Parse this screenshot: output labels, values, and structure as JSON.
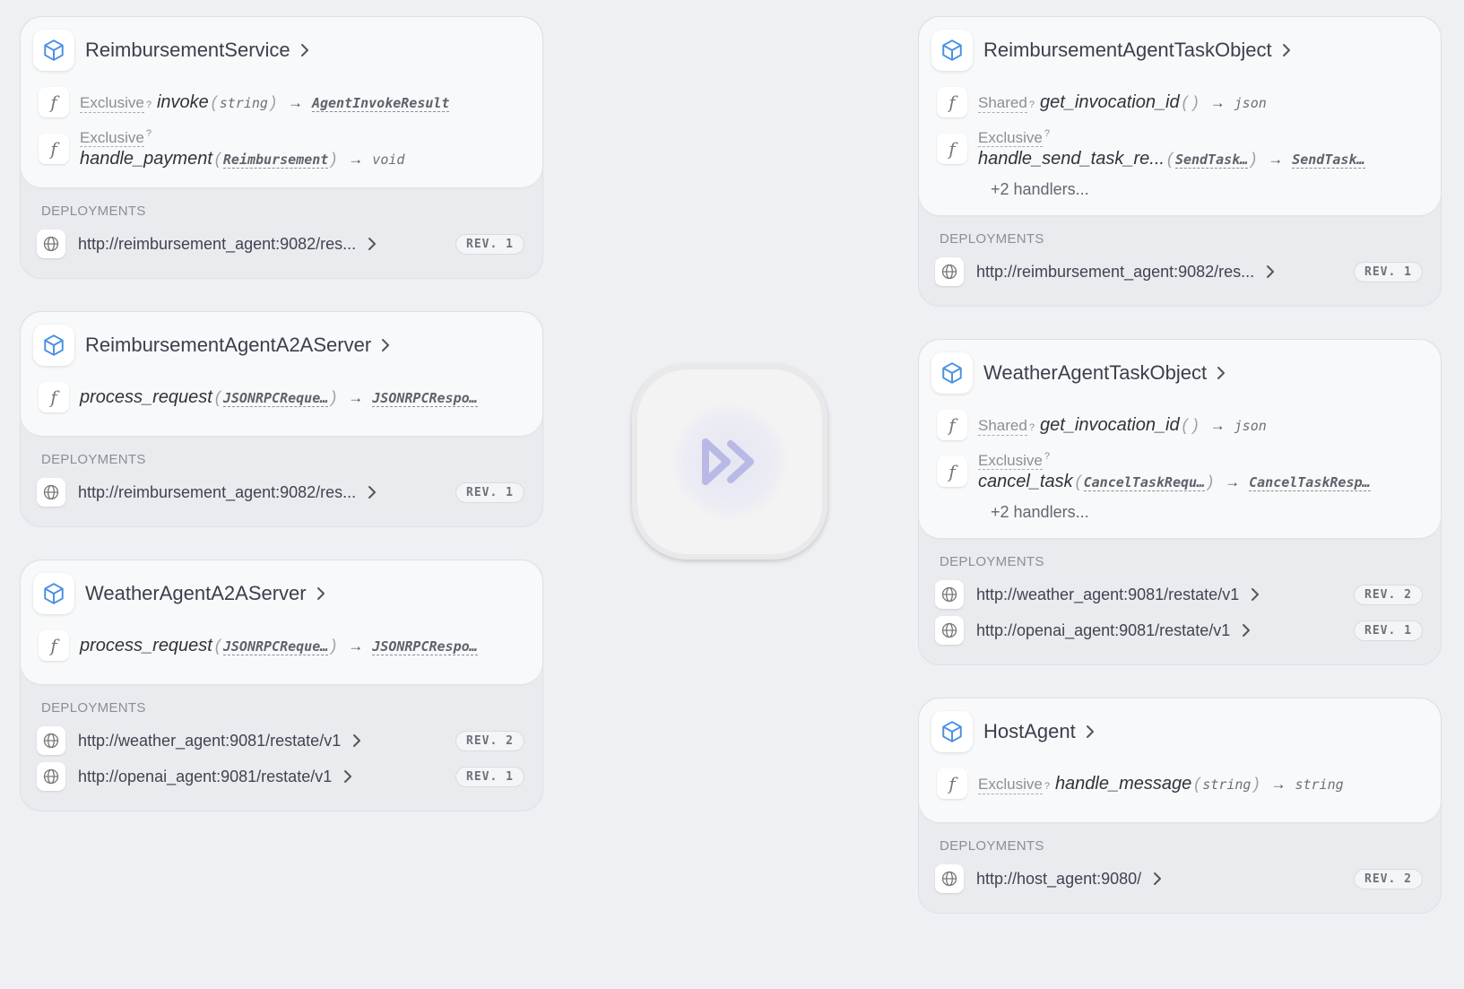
{
  "left_services": [
    {
      "name": "ReimbursementService",
      "handlers": [
        {
          "keyword": "Exclusive",
          "stacked": false,
          "name": "invoke",
          "params": [
            {
              "text": "string",
              "underline": false
            }
          ],
          "returns": {
            "text": "AgentInvokeResult",
            "underline": true
          }
        },
        {
          "keyword": "Exclusive",
          "stacked": true,
          "name": "handle_payment",
          "params": [
            {
              "text": "Reimbursement",
              "underline": true
            }
          ],
          "returns": {
            "text": "void",
            "underline": false
          }
        }
      ],
      "more": "",
      "deployments_label": "DEPLOYMENTS",
      "deployments": [
        {
          "url": "http://reimbursement_agent:9082/res...",
          "rev": "REV. 1"
        }
      ]
    },
    {
      "name": "ReimbursementAgentA2AServer",
      "handlers": [
        {
          "keyword": "",
          "stacked": false,
          "name": "process_request",
          "params": [
            {
              "text": "JSONRPCReque…",
              "underline": true
            }
          ],
          "returns": {
            "text": "JSONRPCRespo…",
            "underline": true
          }
        }
      ],
      "more": "",
      "deployments_label": "DEPLOYMENTS",
      "deployments": [
        {
          "url": "http://reimbursement_agent:9082/res...",
          "rev": "REV. 1"
        }
      ]
    },
    {
      "name": "WeatherAgentA2AServer",
      "handlers": [
        {
          "keyword": "",
          "stacked": false,
          "name": "process_request",
          "params": [
            {
              "text": "JSONRPCReque…",
              "underline": true
            }
          ],
          "returns": {
            "text": "JSONRPCRespo…",
            "underline": true
          }
        }
      ],
      "more": "",
      "deployments_label": "DEPLOYMENTS",
      "deployments": [
        {
          "url": "http://weather_agent:9081/restate/v1",
          "rev": "REV. 2"
        },
        {
          "url": "http://openai_agent:9081/restate/v1",
          "rev": "REV. 1"
        }
      ]
    }
  ],
  "right_services": [
    {
      "name": "ReimbursementAgentTaskObject",
      "handlers": [
        {
          "keyword": "Shared",
          "stacked": false,
          "name": "get_invocation_id",
          "params": [],
          "returns": {
            "text": "json",
            "underline": false
          }
        },
        {
          "keyword": "Exclusive",
          "stacked": true,
          "name": "handle_send_task_re...",
          "params": [
            {
              "text": "SendTask…",
              "underline": true
            }
          ],
          "returns": {
            "text": "SendTask…",
            "underline": true
          }
        }
      ],
      "more": "+2 handlers...",
      "deployments_label": "DEPLOYMENTS",
      "deployments": [
        {
          "url": "http://reimbursement_agent:9082/res...",
          "rev": "REV. 1"
        }
      ]
    },
    {
      "name": "WeatherAgentTaskObject",
      "handlers": [
        {
          "keyword": "Shared",
          "stacked": false,
          "name": "get_invocation_id",
          "params": [],
          "returns": {
            "text": "json",
            "underline": false
          }
        },
        {
          "keyword": "Exclusive",
          "stacked": true,
          "name": "cancel_task",
          "params": [
            {
              "text": "CancelTaskRequ…",
              "underline": true
            }
          ],
          "returns": {
            "text": "CancelTaskResp…",
            "underline": true
          }
        }
      ],
      "more": "+2 handlers...",
      "deployments_label": "DEPLOYMENTS",
      "deployments": [
        {
          "url": "http://weather_agent:9081/restate/v1",
          "rev": "REV. 2"
        },
        {
          "url": "http://openai_agent:9081/restate/v1",
          "rev": "REV. 1"
        }
      ]
    },
    {
      "name": "HostAgent",
      "handlers": [
        {
          "keyword": "Exclusive",
          "stacked": false,
          "name": "handle_message",
          "params": [
            {
              "text": "string",
              "underline": false
            }
          ],
          "returns": {
            "text": "string",
            "underline": false
          }
        }
      ],
      "more": "",
      "deployments_label": "DEPLOYMENTS",
      "deployments": [
        {
          "url": "http://host_agent:9080/",
          "rev": "REV. 2"
        }
      ]
    }
  ],
  "symbols": {
    "keyword_hint": "?",
    "function_glyph": "f",
    "arrow": "→",
    "paren_open": "(",
    "paren_close": ")"
  },
  "colors": {
    "accent": "#4a90e2",
    "logo": "#b9b9e6"
  },
  "logo_icon": "restate-logo-icon"
}
